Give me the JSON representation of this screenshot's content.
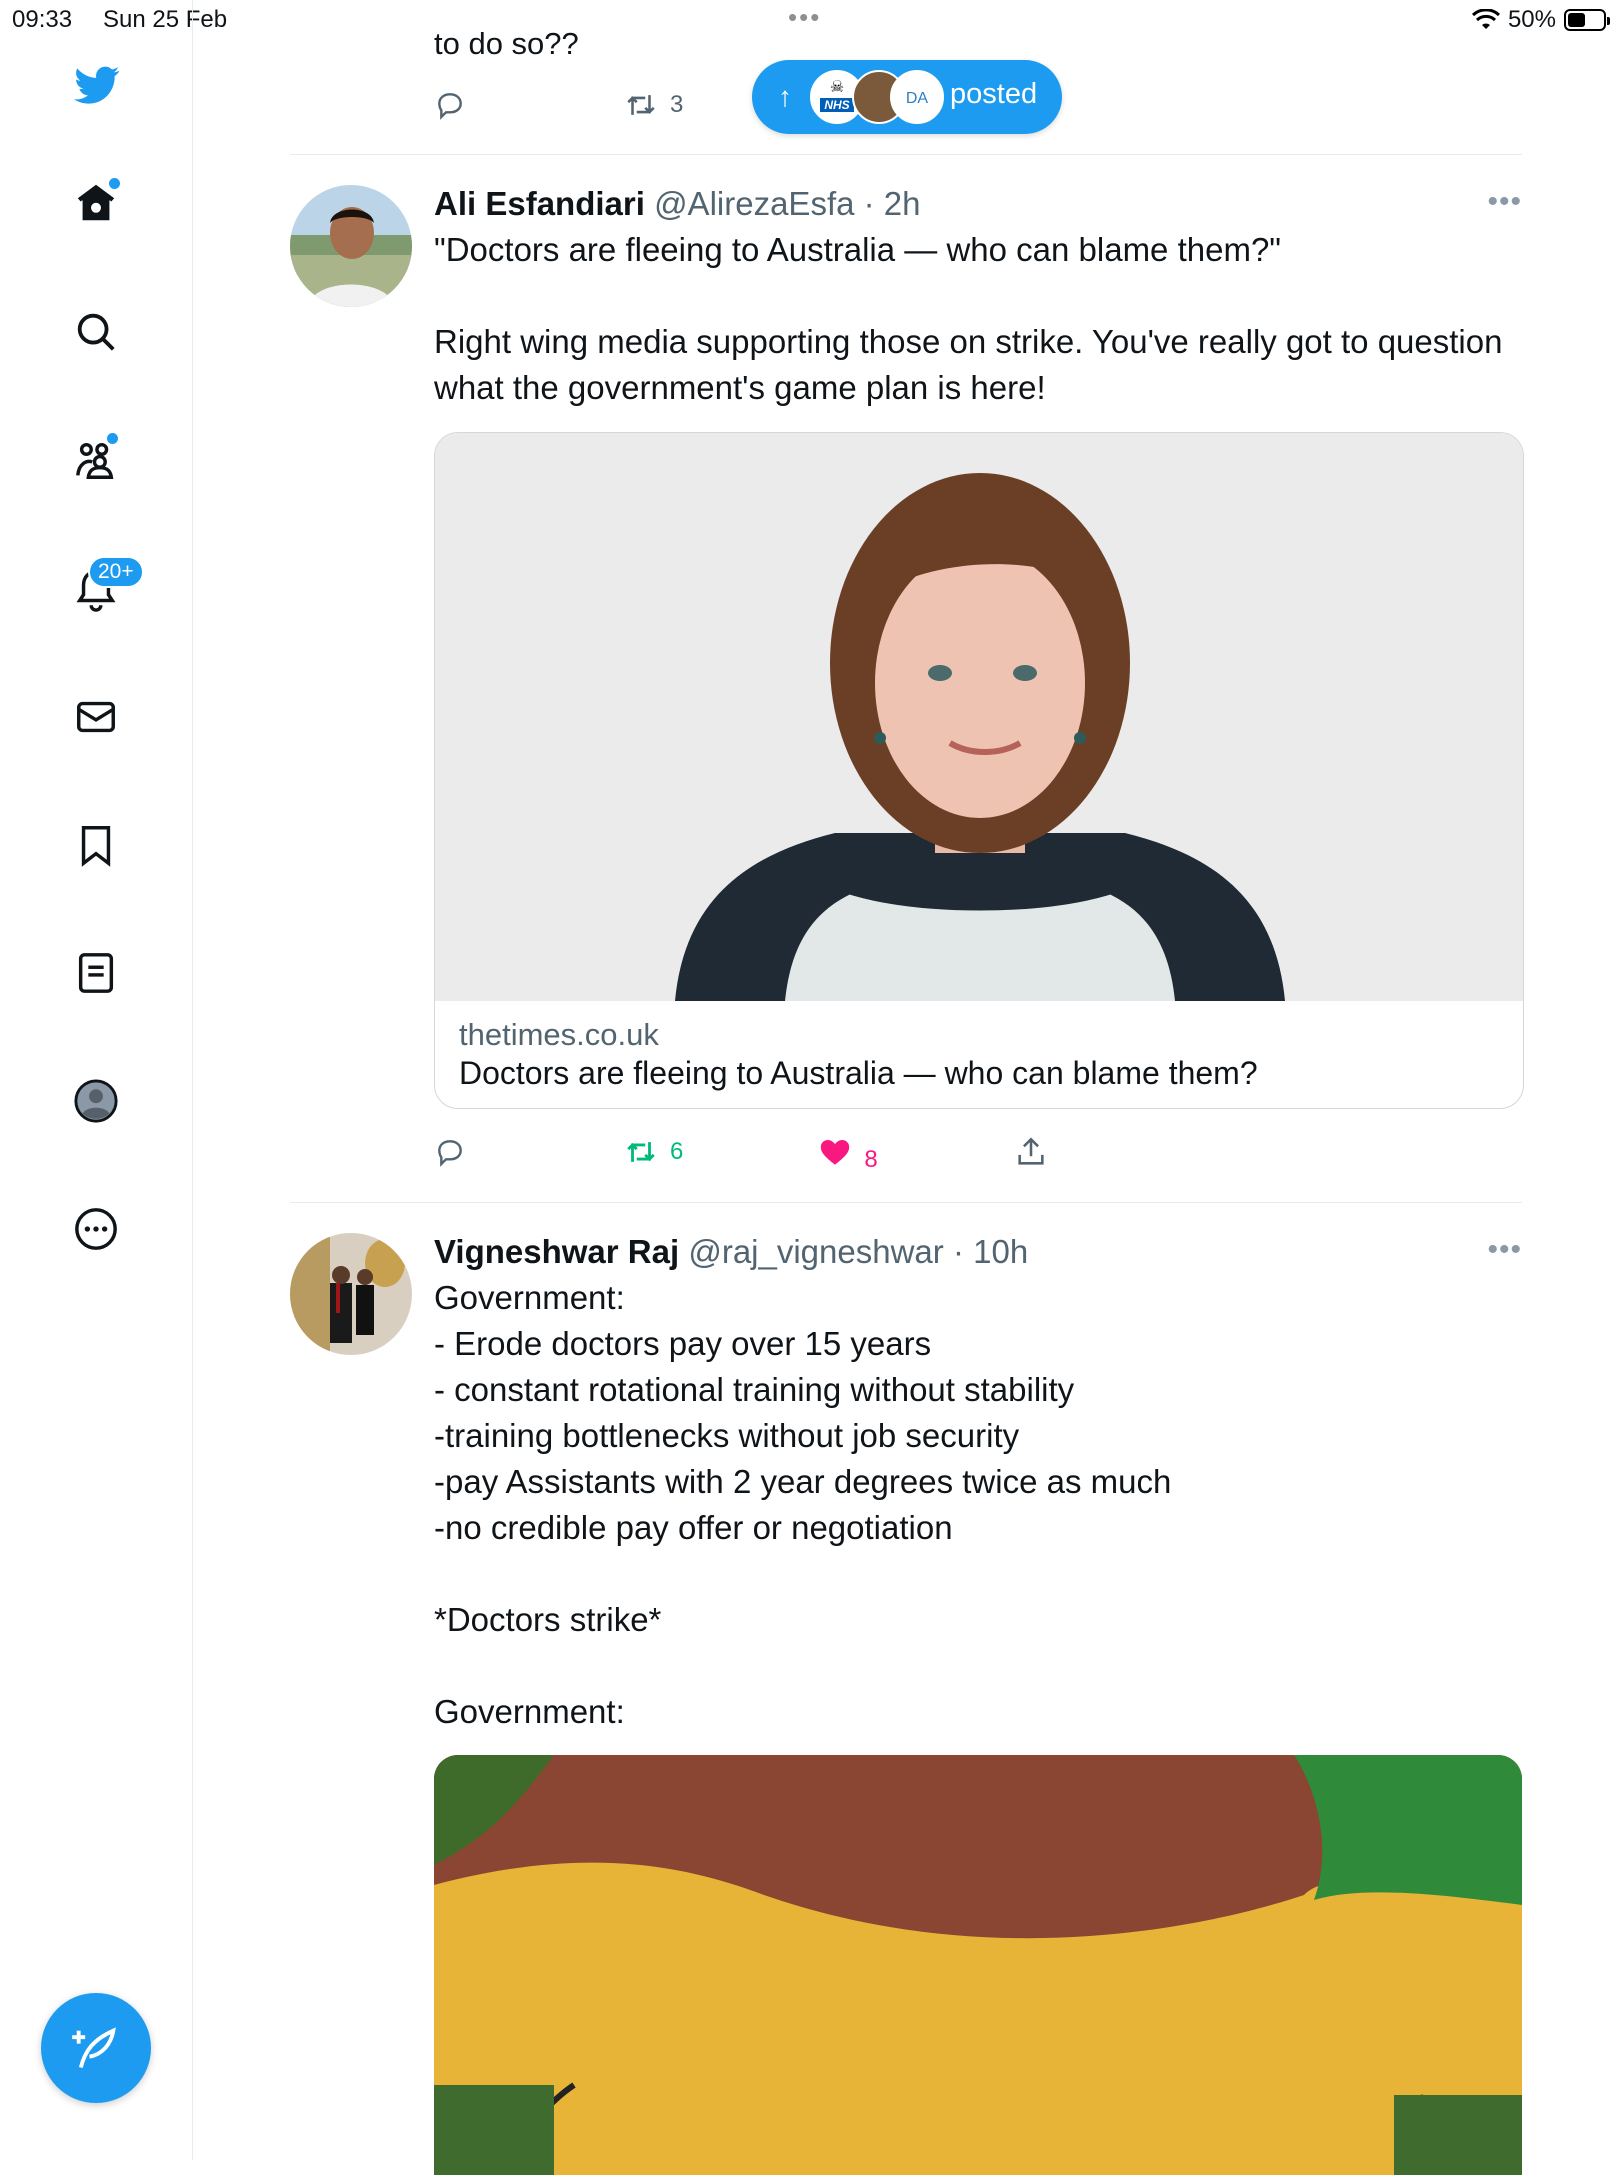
{
  "status_bar": {
    "time": "09:33",
    "date": "Sun 25 Feb",
    "battery": "50%",
    "battery_level": 0.5
  },
  "sidebar": {
    "items": [
      {
        "name": "home",
        "icon": "home-icon",
        "has_dot": true
      },
      {
        "name": "explore",
        "icon": "search-icon"
      },
      {
        "name": "communities",
        "icon": "communities-icon",
        "has_dot": true
      },
      {
        "name": "notifications",
        "icon": "bell-icon",
        "badge": "20+"
      },
      {
        "name": "messages",
        "icon": "mail-icon"
      },
      {
        "name": "bookmarks",
        "icon": "bookmark-icon"
      },
      {
        "name": "lists",
        "icon": "list-icon"
      },
      {
        "name": "profile",
        "icon": "profile-icon"
      },
      {
        "name": "more",
        "icon": "more-circle-icon"
      }
    ],
    "compose_icon": "compose-feather-icon"
  },
  "new_posts_pill": {
    "label": "posted",
    "arrow": "↑",
    "avatar_text": "NHS",
    "avatar_text_2": "DA"
  },
  "feed": {
    "previous_tweet": {
      "text_tail": "to do so??",
      "retweets": "3"
    },
    "tweets": [
      {
        "name": "Ali Esfandiari",
        "handle": "@AlirezaEsfa",
        "time": "· 2h",
        "text": "\"Doctors are fleeing to Australia — who can blame them?\"\n\nRight wing media supporting those on strike. You've really got to question what the government's game plan is here!",
        "card": {
          "domain": "thetimes.co.uk",
          "title": "Doctors are fleeing to Australia — who can blame them?"
        },
        "retweets": "6",
        "likes": "8",
        "liked": true,
        "retweeted": true
      },
      {
        "name": "Vigneshwar Raj",
        "handle": "@raj_vigneshwar",
        "time": "· 10h",
        "text": "Government:\n- Erode doctors pay over 15 years\n- constant rotational training without stability\n-training bottlenecks without job security\n-pay Assistants with 2 year degrees twice as much\n-no credible pay offer or negotiation\n\n*Doctors strike*\n\nGovernment:"
      }
    ]
  },
  "colors": {
    "accent": "#1d9bf0",
    "like": "#f91880",
    "retweet": "#00ba7c",
    "muted": "#536471"
  }
}
